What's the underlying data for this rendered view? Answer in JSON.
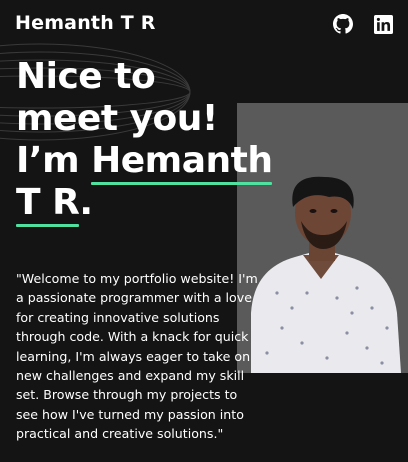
{
  "header": {
    "brand": "Hemanth T R",
    "links": [
      {
        "icon": "github-icon"
      },
      {
        "icon": "linkedin-icon"
      }
    ]
  },
  "hero": {
    "line1": "Nice to",
    "line2": "meet you!",
    "line3_prefix": "I’m",
    "name_part1": "Hemanth",
    "name_part2": "T R",
    "name_suffix": ".",
    "intro": "\"Welcome to my portfolio website! I'm a passionate programmer with a love for creating innovative solutions through code. With a knack for quick learning, I'm always eager to take on new challenges and expand my skill set. Browse through my projects to see how I've turned my passion into practical and creative solutions.\""
  },
  "colors": {
    "background": "#141414",
    "accent": "#4ee1a0",
    "photo_bg": "#5a5a5a"
  }
}
